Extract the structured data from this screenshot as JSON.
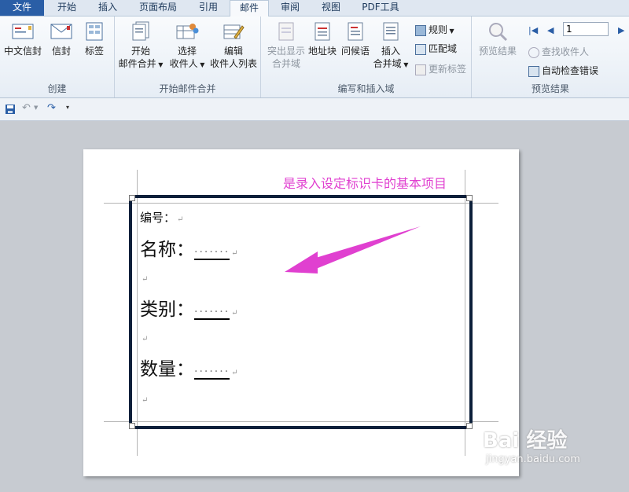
{
  "tabs": [
    "文件",
    "开始",
    "插入",
    "页面布局",
    "引用",
    "邮件",
    "审阅",
    "视图",
    "PDF工具"
  ],
  "ribbon": {
    "create": {
      "label": "创建",
      "btn1": "中文信封",
      "btn2": "信封",
      "btn3": "标签"
    },
    "start_merge": {
      "label": "开始邮件合并",
      "btn1a": "开始",
      "btn1b": "邮件合并",
      "btn2a": "选择",
      "btn2b": "收件人",
      "btn3a": "编辑",
      "btn3b": "收件人列表"
    },
    "write_insert": {
      "label": "编写和插入域",
      "highlight_a": "突出显示",
      "highlight_b": "合并域",
      "address": "地址块",
      "greeting": "问候语",
      "insert_a": "插入",
      "insert_b": "合并域",
      "rules": "规则",
      "match": "匹配域",
      "update": "更新标签"
    },
    "preview": {
      "label": "预览结果",
      "preview_btn": "预览结果",
      "page_value": "1",
      "find": "查找收件人",
      "check": "自动检查错误"
    }
  },
  "document": {
    "line1": "编号：",
    "line2_label": "名称：",
    "line3_label": "类别：",
    "line4_label": "数量：",
    "field_dots": "·······",
    "para_mark": "↵"
  },
  "annotation": "是录入设定标识卡的基本项目",
  "watermark": {
    "text": "Bai 经验",
    "sub": "jingyan.baidu.com"
  },
  "colors": {
    "accent": "#2a5ea6",
    "annotation": "#e040d0",
    "card_border": "#0c1f3a"
  }
}
